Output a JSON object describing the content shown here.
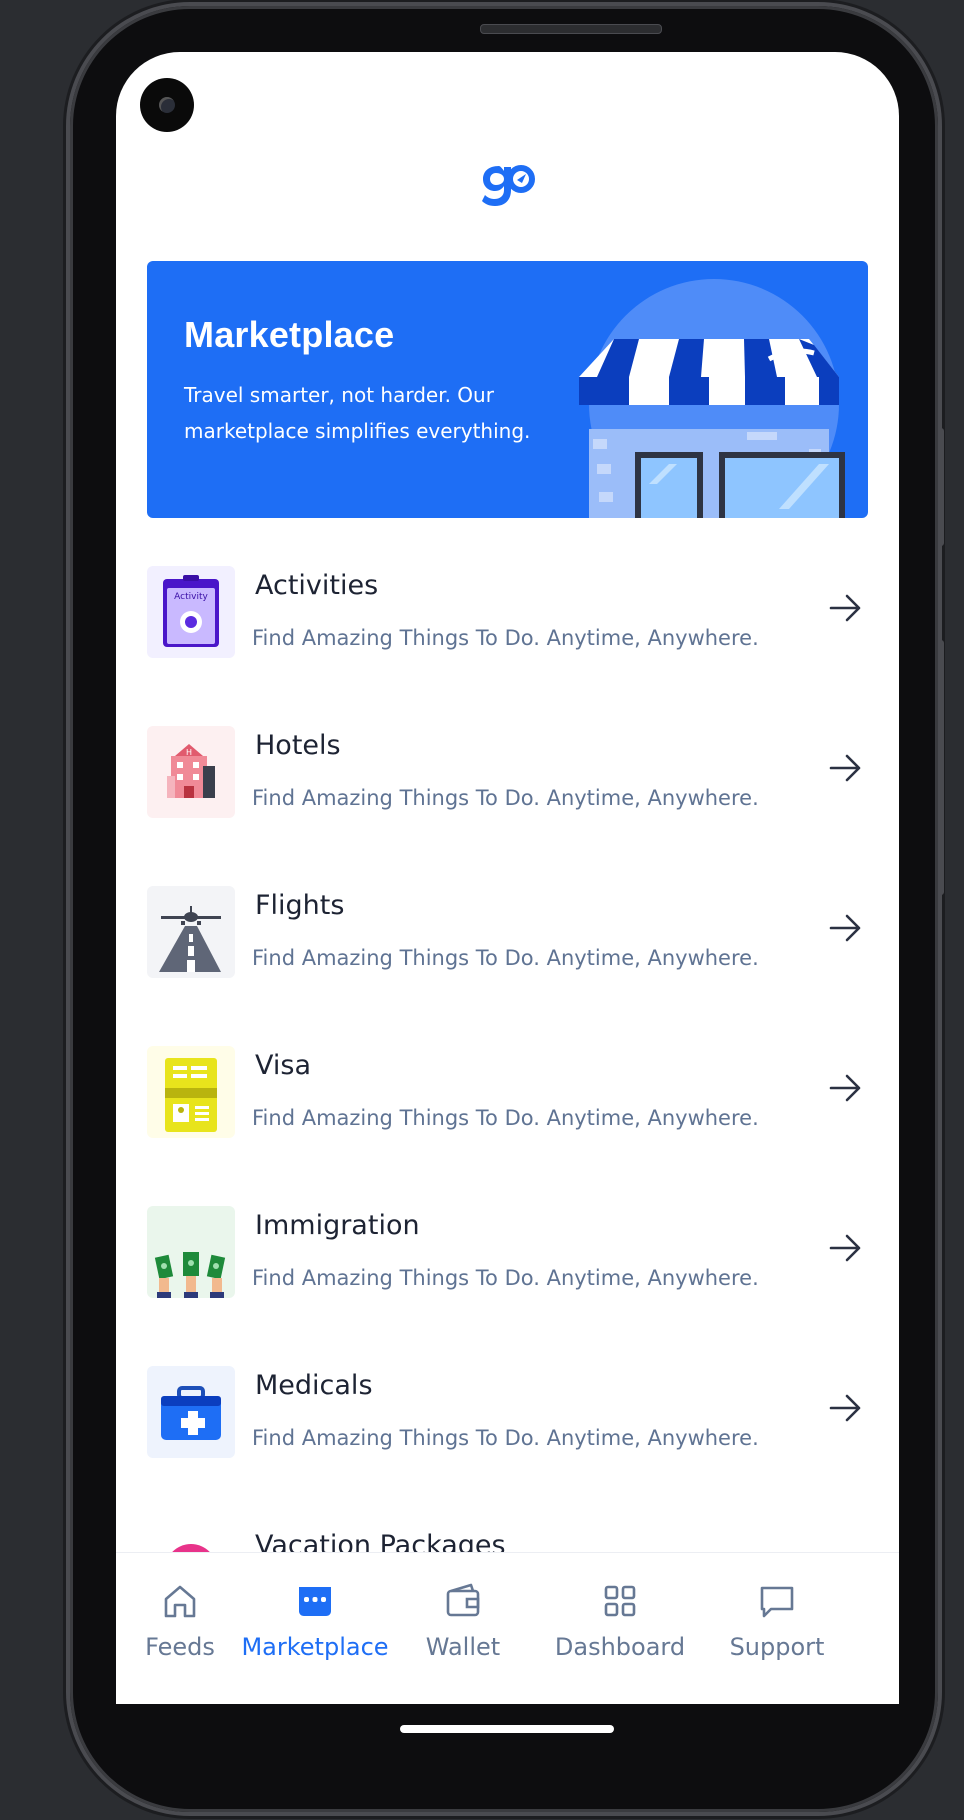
{
  "app": {
    "logo_text": "go",
    "brand_color": "#1e6ef5"
  },
  "hero": {
    "title": "Marketplace",
    "subtitle": "Travel smarter, not harder. Our marketplace simplifies everything.",
    "background": "#1e6ef5",
    "illustration": "storefront-illustration"
  },
  "services": [
    {
      "title": "Activities",
      "subtitle": "Find Amazing Things To Do. Anytime, Anywhere.",
      "icon": "activity-pass-icon",
      "thumb_bg": "#f2f0ff",
      "thumb_label": "Activity"
    },
    {
      "title": "Hotels",
      "subtitle": "Find Amazing Things To Do. Anytime, Anywhere.",
      "icon": "hotel-building-icon",
      "thumb_bg": "#fdf0f1",
      "thumb_label": "H"
    },
    {
      "title": "Flights",
      "subtitle": "Find Amazing Things To Do. Anytime, Anywhere.",
      "icon": "airplane-runway-icon",
      "thumb_bg": "#f3f4f7"
    },
    {
      "title": "Visa",
      "subtitle": "Find Amazing Things To Do. Anytime, Anywhere.",
      "icon": "visa-document-icon",
      "thumb_bg": "#fffde8"
    },
    {
      "title": "Immigration",
      "subtitle": "Find Amazing Things To Do. Anytime, Anywhere.",
      "icon": "immigration-cash-icon",
      "thumb_bg": "#eaf6ec"
    },
    {
      "title": "Medicals",
      "subtitle": "Find Amazing Things To Do. Anytime, Anywhere.",
      "icon": "medical-kit-icon",
      "thumb_bg": "#eef3fd"
    },
    {
      "title": "Vacation Packages",
      "subtitle": "",
      "icon": "vacation-icon",
      "thumb_bg": "#fff"
    }
  ],
  "nav": {
    "items": [
      {
        "label": "Feeds",
        "icon": "home-icon",
        "active": false
      },
      {
        "label": "Marketplace",
        "icon": "store-icon",
        "active": true
      },
      {
        "label": "Wallet",
        "icon": "wallet-icon",
        "active": false
      },
      {
        "label": "Dashboard",
        "icon": "grid-icon",
        "active": false
      },
      {
        "label": "Support",
        "icon": "chat-icon",
        "active": false
      }
    ],
    "active_color": "#1e6ef5",
    "inactive_color": "#667894"
  }
}
